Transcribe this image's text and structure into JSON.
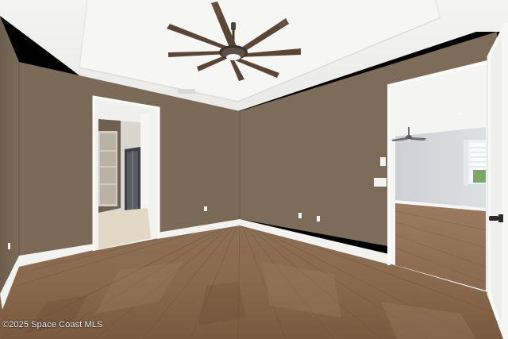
{
  "watermark": {
    "text": "©2025 Space Coast MLS"
  },
  "colors": {
    "wall": "#7b6a58",
    "ceiling": "#f1f1ef",
    "floor": "#8a6b4f",
    "trim": "#f3f3f1",
    "adjacent_wall": "#d7d9dc"
  },
  "icons": {
    "ceiling_fan_main": "ceiling-fan-icon",
    "ceiling_fan_adjacent": "ceiling-fan-icon"
  }
}
